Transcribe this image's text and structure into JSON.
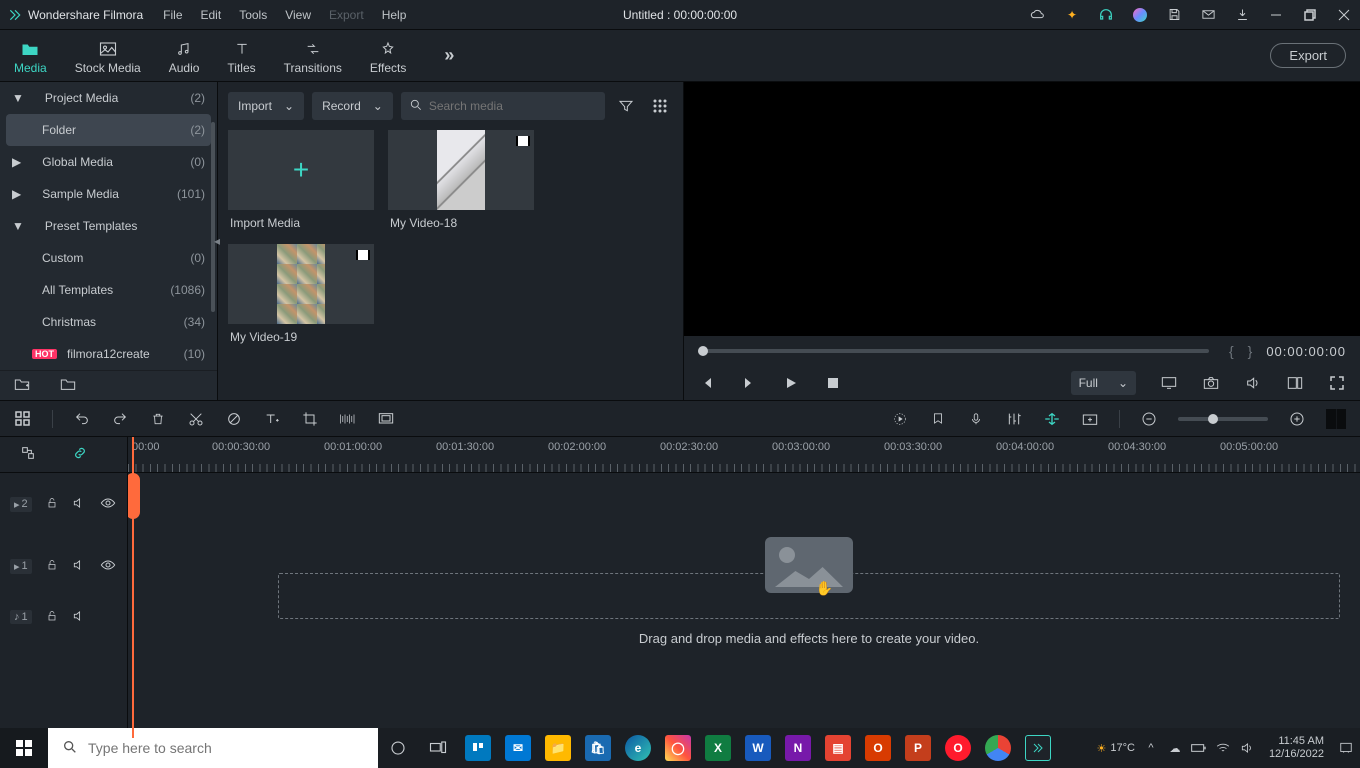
{
  "app": {
    "name": "Wondershare Filmora"
  },
  "menu": {
    "file": "File",
    "edit": "Edit",
    "tools": "Tools",
    "view": "View",
    "export": "Export",
    "help": "Help"
  },
  "doc": {
    "title": "Untitled : 00:00:00:00"
  },
  "tabs": {
    "media": "Media",
    "stock": "Stock Media",
    "audio": "Audio",
    "titles": "Titles",
    "transitions": "Transitions",
    "effects": "Effects",
    "export_btn": "Export"
  },
  "sidebar": {
    "items": [
      {
        "label": "Project Media",
        "count": "(2)",
        "chev": "▼"
      },
      {
        "label": "Folder",
        "count": "(2)",
        "selected": true,
        "indent": true
      },
      {
        "label": "Global Media",
        "count": "(0)",
        "chev": "▶"
      },
      {
        "label": "Sample Media",
        "count": "(101)",
        "chev": "▶"
      },
      {
        "label": "Preset Templates",
        "count": "",
        "chev": "▼"
      },
      {
        "label": "Custom",
        "count": "(0)",
        "indent": true
      },
      {
        "label": "All Templates",
        "count": "(1086)",
        "indent": true
      },
      {
        "label": "Christmas",
        "count": "(34)",
        "indent": true
      },
      {
        "label": "filmora12create",
        "count": "(10)",
        "indent": true,
        "hot": true
      }
    ]
  },
  "media_toolbar": {
    "import": "Import",
    "record": "Record",
    "search_ph": "Search media"
  },
  "media": {
    "tiles": [
      {
        "label": "Import Media",
        "type": "import"
      },
      {
        "label": "My Video-18",
        "type": "video1"
      },
      {
        "label": "My Video-19",
        "type": "video2"
      }
    ]
  },
  "preview": {
    "time": "00:00:00:00",
    "fit": "Full"
  },
  "ruler": {
    "marks": [
      "00:00",
      "00:00:30:00",
      "00:01:00:00",
      "00:01:30:00",
      "00:02:00:00",
      "00:02:30:00",
      "00:03:00:00",
      "00:03:30:00",
      "00:04:00:00",
      "00:04:30:00",
      "00:05:00:00"
    ]
  },
  "tracks": {
    "v2": "2",
    "v1": "1",
    "a1": "1"
  },
  "dropzone": {
    "text": "Drag and drop media and effects here to create your video."
  },
  "taskbar": {
    "search_ph": "Type here to search",
    "weather": "17°C",
    "clock_time": "11:45 AM",
    "clock_date": "12/16/2022"
  }
}
